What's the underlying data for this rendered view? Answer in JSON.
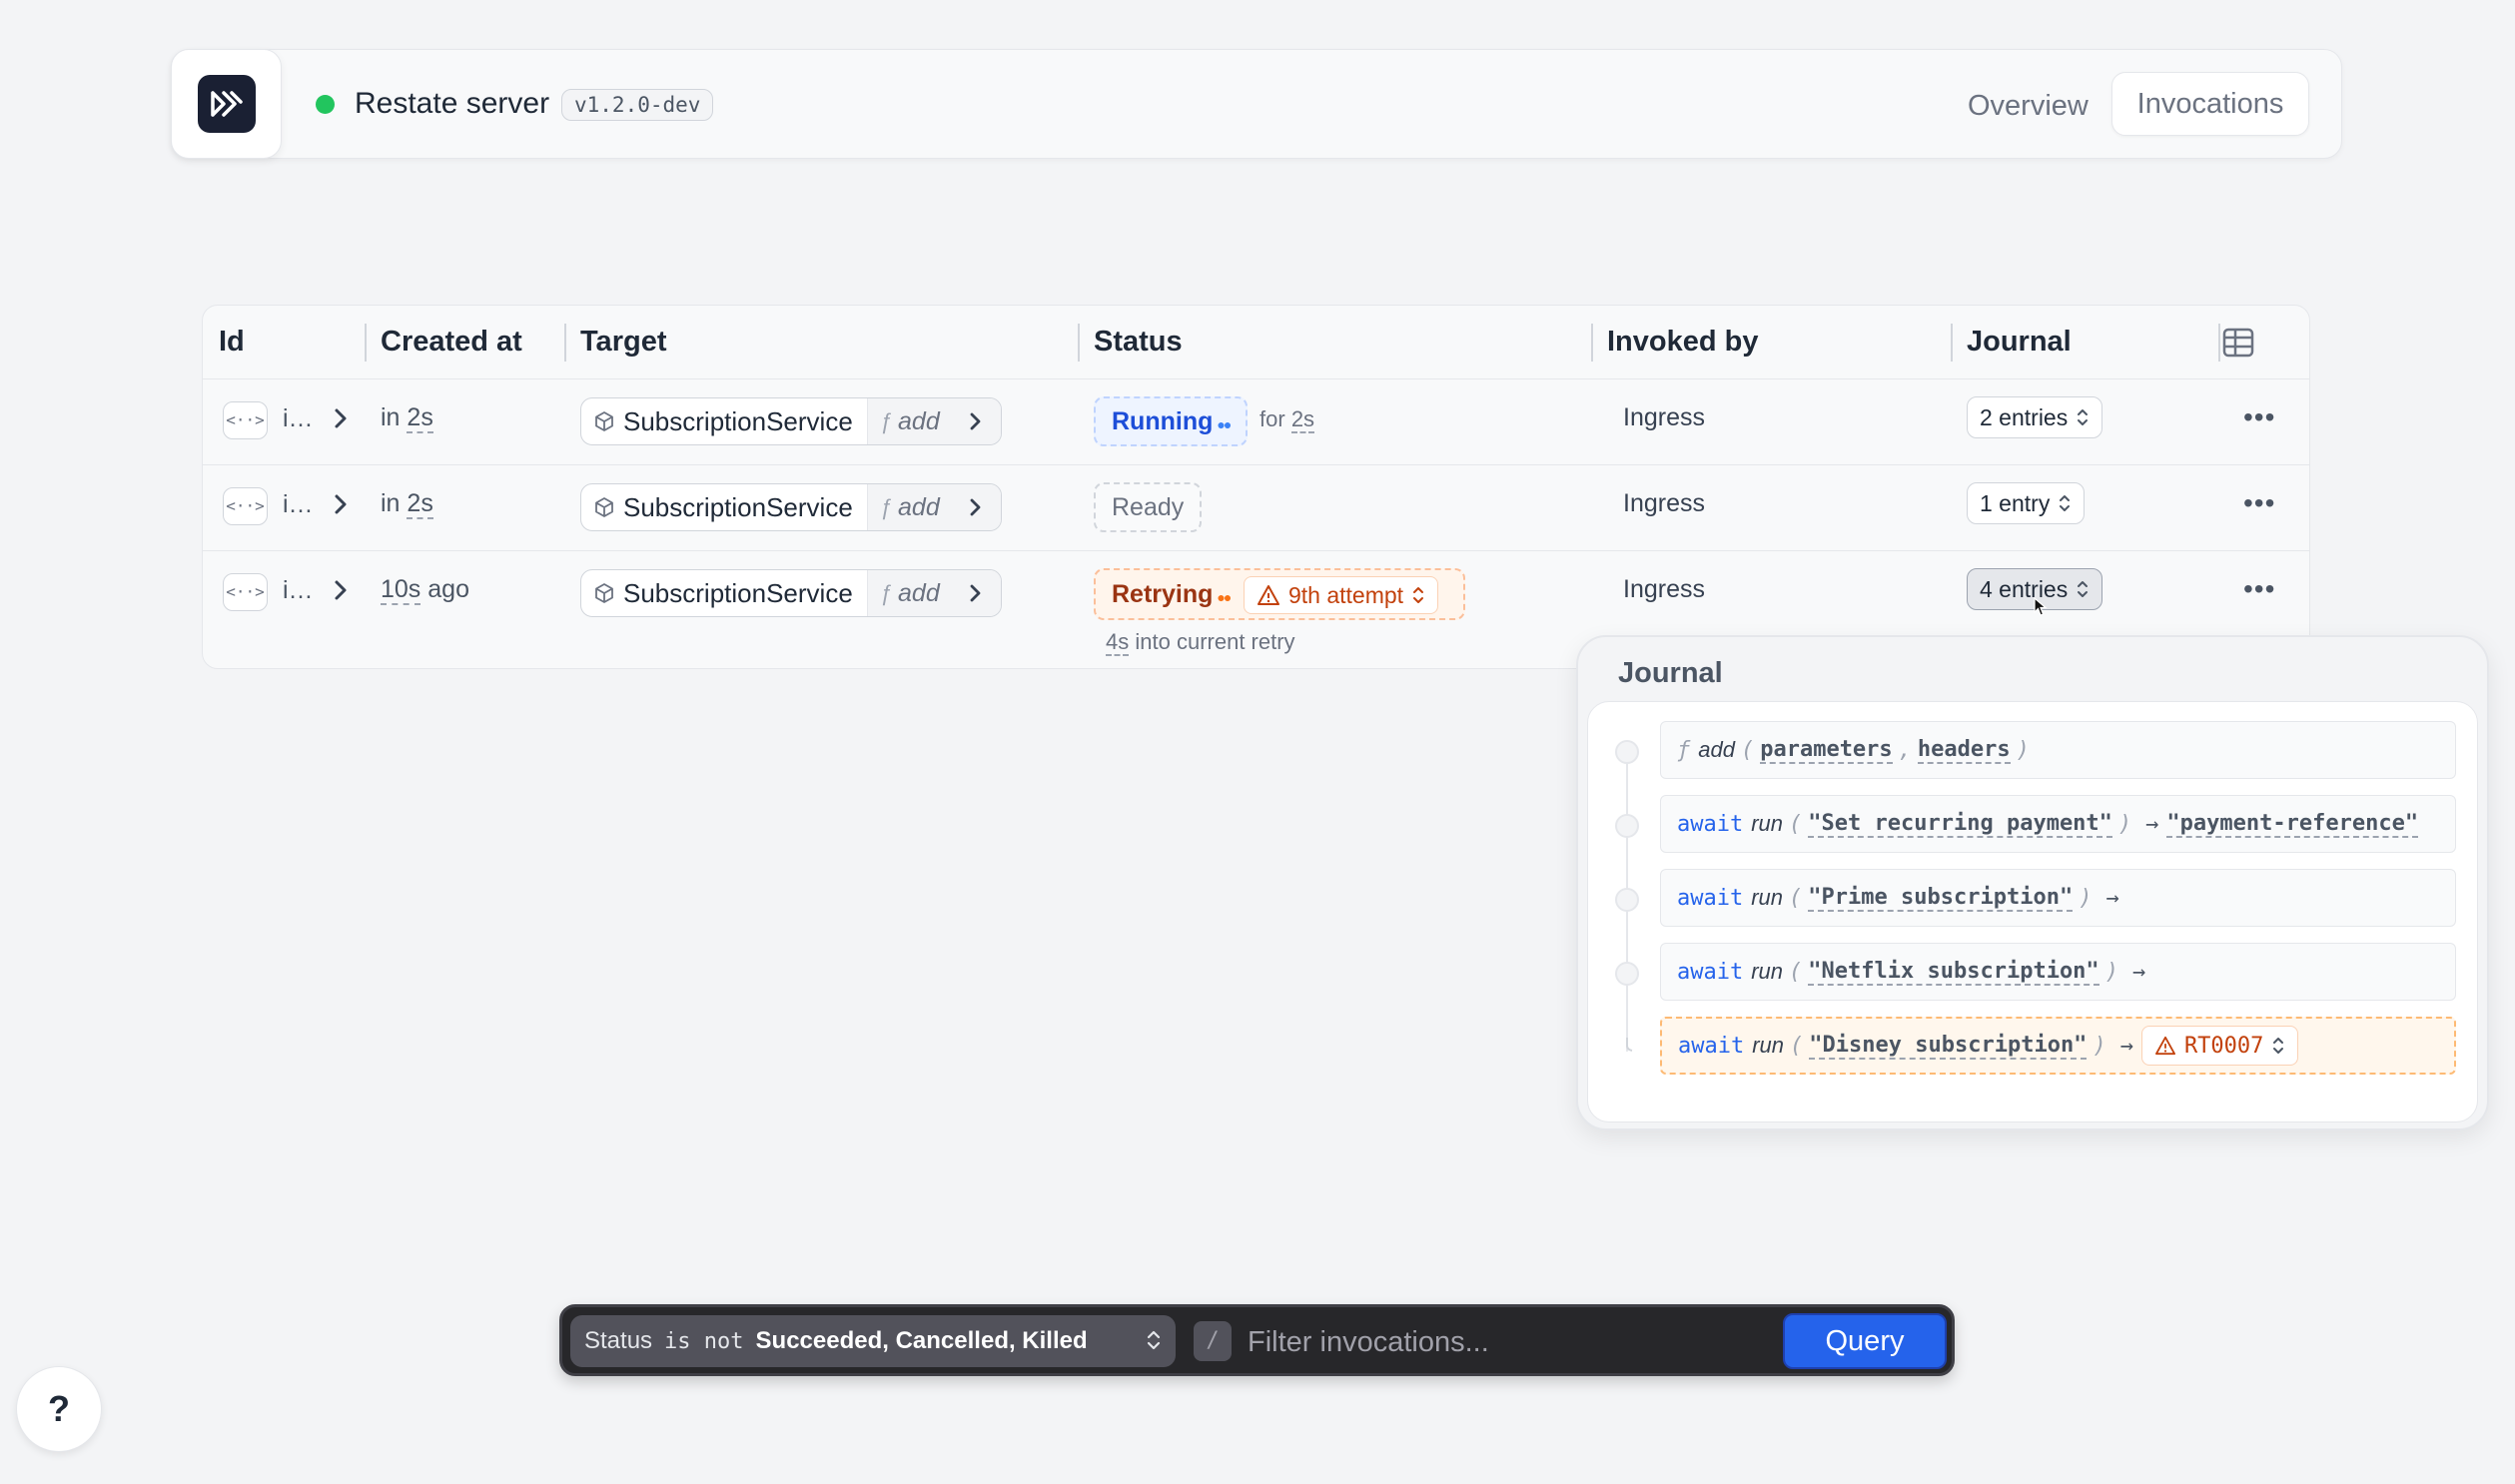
{
  "header": {
    "server_name": "Restate server",
    "version": "v1.2.0-dev",
    "status_color": "#22c55e",
    "nav": {
      "overview": "Overview",
      "invocations": "Invocations"
    }
  },
  "table": {
    "columns": [
      "Id",
      "Created at",
      "Target",
      "Status",
      "Invoked by",
      "Journal"
    ],
    "rows": [
      {
        "id": "i…",
        "created_prefix": "in",
        "created_value": "2s",
        "created_suffix": "",
        "service": "SubscriptionService",
        "handler": "add",
        "status": "Running",
        "status_meta_prefix": "for",
        "status_meta_value": "2s",
        "invoked_by": "Ingress",
        "journal": "2 entries"
      },
      {
        "id": "i…",
        "created_prefix": "in",
        "created_value": "2s",
        "created_suffix": "",
        "service": "SubscriptionService",
        "handler": "add",
        "status": "Ready",
        "invoked_by": "Ingress",
        "journal": "1 entry"
      },
      {
        "id": "i…",
        "created_prefix": "",
        "created_value": "10s",
        "created_suffix": "ago",
        "service": "SubscriptionService",
        "handler": "add",
        "status": "Retrying",
        "attempt": "9th attempt",
        "retry_value": "4s",
        "retry_suffix": "into current retry",
        "invoked_by": "Ingress",
        "journal": "4 entries"
      }
    ]
  },
  "journal_popover": {
    "title": "Journal",
    "entries": [
      {
        "keyword": "",
        "fn": "add",
        "args": [
          "parameters",
          "headers"
        ],
        "result": ""
      },
      {
        "keyword": "await",
        "fn": "run",
        "args": [
          "\"Set recurring payment\""
        ],
        "result": "\"payment-reference\""
      },
      {
        "keyword": "await",
        "fn": "run",
        "args": [
          "\"Prime subscription\""
        ],
        "result": ""
      },
      {
        "keyword": "await",
        "fn": "run",
        "args": [
          "\"Netflix subscription\""
        ],
        "result": ""
      },
      {
        "keyword": "await",
        "fn": "run",
        "args": [
          "\"Disney subscription\""
        ],
        "error_code": "RT0007"
      }
    ]
  },
  "filter": {
    "field": "Status",
    "operator": "is not",
    "value": "Succeeded, Cancelled, Killed",
    "shortcut": "/",
    "placeholder": "Filter invocations...",
    "query_label": "Query"
  },
  "help": {
    "label": "?"
  },
  "colors": {
    "accent": "#2563eb",
    "running": "#1d4ed8",
    "retrying": "#9a3412",
    "warning": "#c2410c",
    "success": "#22c55e"
  }
}
